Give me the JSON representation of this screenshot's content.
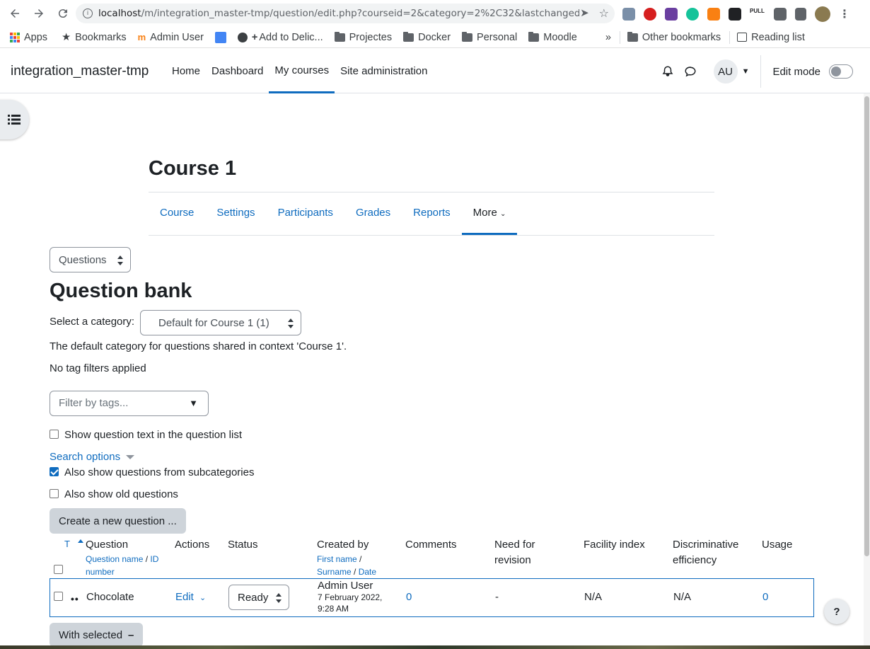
{
  "browser": {
    "url_host": "localhost",
    "url_path": "/m/integration_master-tmp/question/edit.php?courseid=2&category=2%2C32&lastchanged=...",
    "bookmarks": [
      {
        "label": "Apps"
      },
      {
        "label": "Bookmarks"
      },
      {
        "label": "Admin User"
      },
      {
        "label": ""
      },
      {
        "label": "Add to Delic..."
      },
      {
        "label": "Projectes"
      },
      {
        "label": "Docker"
      },
      {
        "label": "Personal"
      },
      {
        "label": "Moodle"
      }
    ],
    "overflow": "»",
    "other_bookmarks": "Other bookmarks",
    "reading_list": "Reading list"
  },
  "navbar": {
    "brand": "integration_master-tmp",
    "items": [
      "Home",
      "Dashboard",
      "My courses",
      "Site administration"
    ],
    "active_index": 2,
    "avatar_initials": "AU",
    "edit_mode_label": "Edit mode",
    "edit_mode_on": false
  },
  "course": {
    "title": "Course 1",
    "tabs": [
      "Course",
      "Settings",
      "Participants",
      "Grades",
      "Reports",
      "More"
    ],
    "active_tab": "More"
  },
  "page": {
    "nav_select": "Questions",
    "heading": "Question bank",
    "category_label": "Select a category:",
    "category_value": "Default for Course 1 (1)",
    "category_description": "The default category for questions shared in context 'Course 1'.",
    "tag_status": "No tag filters applied",
    "tag_filter_placeholder": "Filter by tags...",
    "show_question_text_label": "Show question text in the question list",
    "show_question_text_checked": false,
    "search_options_label": "Search options",
    "subcategories_label": "Also show questions from subcategories",
    "subcategories_checked": true,
    "old_questions_label": "Also show old questions",
    "old_questions_checked": false,
    "create_button": "Create a new question ...",
    "with_selected_button": "With selected"
  },
  "table": {
    "headers": {
      "type": "T",
      "question": "Question",
      "question_sub_name": "Question name",
      "question_sub_sep": " / ",
      "question_sub_id": "ID number",
      "actions": "Actions",
      "status": "Status",
      "created_by": "Created by",
      "created_sub_first": "First name",
      "created_sub_surname": "Surname",
      "created_sub_date": "Date",
      "comments": "Comments",
      "need_revision": "Need for revision",
      "facility": "Facility index",
      "discriminative": "Discriminative efficiency",
      "usage": "Usage"
    },
    "rows": [
      {
        "name": "Chocolate",
        "action": "Edit",
        "status": "Ready",
        "creator": "Admin User",
        "created_date": "7 February 2022,",
        "created_time": "9:28 AM",
        "comments": "0",
        "need_revision": "-",
        "facility": "N/A",
        "discriminative": "N/A",
        "usage": "0"
      }
    ]
  },
  "help_label": "?",
  "colors": {
    "link": "#0f6cbf",
    "text": "#1d2125",
    "button_secondary": "#ced4da"
  }
}
